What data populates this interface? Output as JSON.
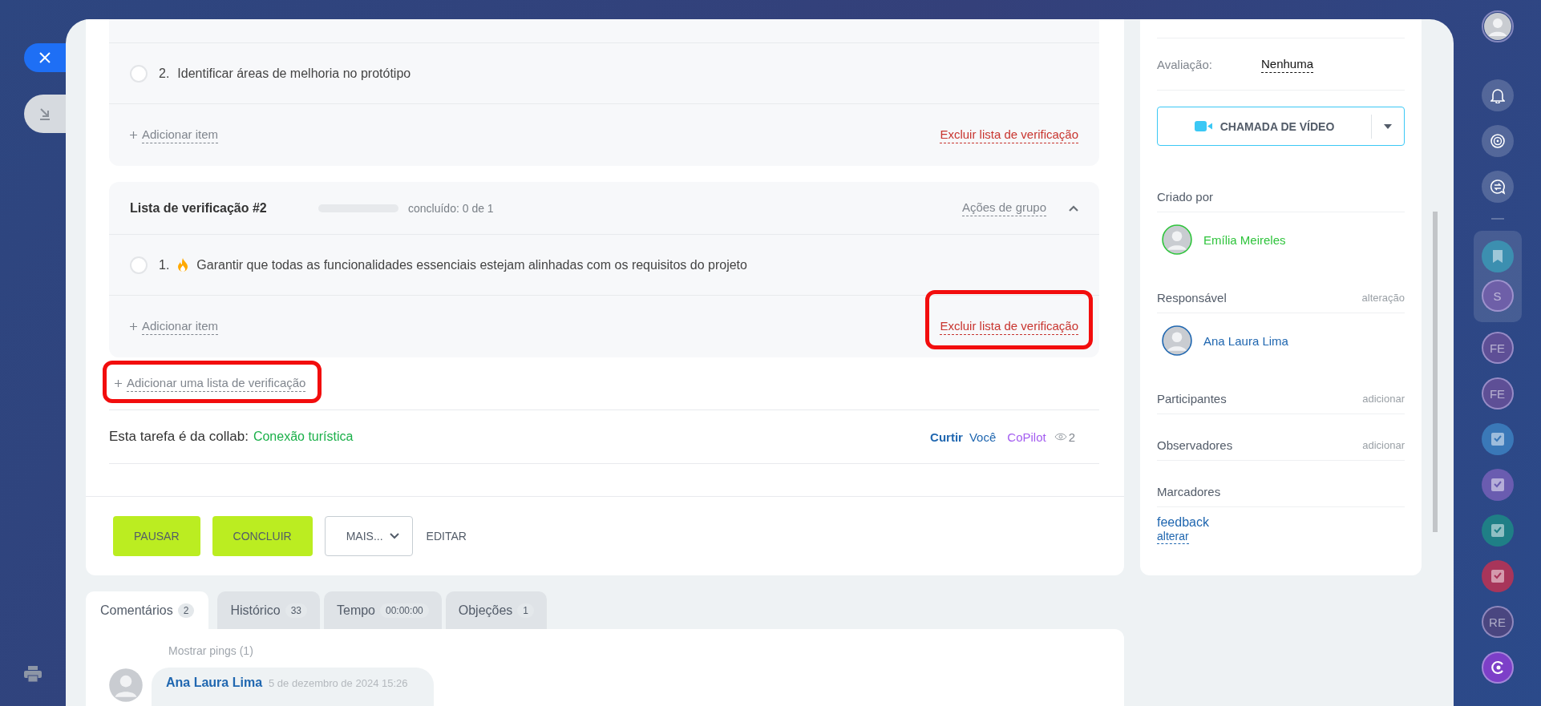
{
  "checklists": [
    {
      "items": [
        {
          "number": "2.",
          "text": "Identificar áreas de melhoria no protótipo",
          "done": false
        }
      ],
      "add_item": "Adicionar item",
      "delete": {
        "label": "Excluir lista de verificação"
      }
    },
    {
      "title": "Lista de verificação #2",
      "progress": {
        "level": 0,
        "label": "concluído: 0 de 1"
      },
      "group_actions": "Ações de grupo",
      "expanded": true,
      "items": [
        {
          "number": "1.",
          "text": "Garantir que todas as funcionalidades essenciais estejam alinhadas com os requisitos do projeto",
          "done": false,
          "important": true
        }
      ],
      "add_item": "Adicionar item",
      "delete": {
        "label": "Excluir lista de verificação",
        "highlighted": true
      }
    }
  ],
  "add_checklist": {
    "label": "Adicionar uma lista de verificação",
    "highlighted": true
  },
  "collab": {
    "label": "Esta tarefa é da collab:",
    "name": "Conexão turística"
  },
  "likes": {
    "like": "Curtir",
    "you": "Você",
    "copilot": "CoPilot",
    "views": "2"
  },
  "actions": [
    {
      "kind": "primary",
      "label": "PAUSAR"
    },
    {
      "kind": "primary",
      "label": "CONCLUIR"
    },
    {
      "kind": "dropdown",
      "label": "MAIS..."
    },
    {
      "kind": "link",
      "label": "EDITAR"
    }
  ],
  "tabs": [
    {
      "label": "Comentários",
      "count": "2",
      "selected": true
    },
    {
      "label": "Histórico",
      "count": "33",
      "selected": false
    },
    {
      "label": "Tempo",
      "count": "00:00:00",
      "selected": false
    },
    {
      "label": "Objeções",
      "count": "1",
      "selected": false
    }
  ],
  "comments": {
    "show_pings": "Mostrar pings (1)",
    "items": [
      {
        "author": "Ana Laura Lima",
        "date": "5 de dezembro de 2024 15:26"
      }
    ]
  },
  "sidebar": {
    "rating": {
      "label": "Avaliação:",
      "value": "Nenhuma"
    },
    "video_call": "CHAMADA DE VÍDEO",
    "sections": [
      {
        "title": "Criado por",
        "people": [
          {
            "name": "Emília Meireles",
            "color": "#2fc43c"
          }
        ]
      },
      {
        "title": "Responsável",
        "action": "alteração",
        "people": [
          {
            "name": "Ana Laura Lima",
            "color": "#2067b0"
          }
        ]
      },
      {
        "title": "Participantes",
        "action": "adicionar"
      },
      {
        "title": "Observadores",
        "action": "adicionar"
      },
      {
        "title": "Marcadores"
      }
    ],
    "tags": {
      "items": [
        "feedback"
      ],
      "change": "alterar"
    }
  },
  "right_rail": [
    {
      "kind": "avatar"
    },
    {
      "kind": "bell"
    },
    {
      "kind": "target"
    },
    {
      "kind": "chat"
    },
    {
      "kind": "separator"
    },
    {
      "kind": "bookmark",
      "color": "#3c8fb0",
      "group": true
    },
    {
      "kind": "letters",
      "text": "S",
      "color": "#6e5fa8",
      "group": true
    },
    {
      "kind": "letters",
      "text": "FE",
      "color": "#5e4f96"
    },
    {
      "kind": "letters",
      "text": "FE",
      "color": "#5e4f96"
    },
    {
      "kind": "task",
      "color": "#3a78b8"
    },
    {
      "kind": "task",
      "color": "#6a5cb0"
    },
    {
      "kind": "task",
      "color": "#1f7f86"
    },
    {
      "kind": "task",
      "color": "#a8355a"
    },
    {
      "kind": "letters",
      "text": "RE",
      "color": "#4a4680"
    },
    {
      "kind": "copilot",
      "color": "#7d3fc8"
    }
  ]
}
